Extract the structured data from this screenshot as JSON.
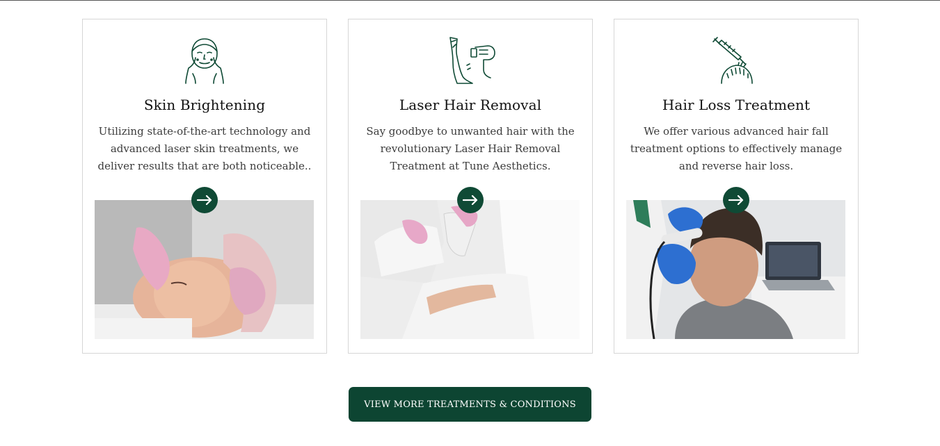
{
  "cards": [
    {
      "icon": "face-icon",
      "title": "Skin Brightening",
      "description": "Utilizing state-of-the-art technology and advanced laser skin treatments, we deliver results that are both noticeable..",
      "image": "facial-treatment-photo"
    },
    {
      "icon": "laser-leg-icon",
      "title": "Laser Hair Removal",
      "description": "Say goodbye to unwanted hair with the revolutionary Laser Hair Removal Treatment at Tune Aesthetics.",
      "image": "laser-hair-removal-photo"
    },
    {
      "icon": "syringe-scalp-icon",
      "title": "Hair Loss Treatment",
      "description": "We offer various advanced hair fall treatment options to effectively manage and reverse hair loss.",
      "image": "hair-loss-treatment-photo"
    }
  ],
  "cta": {
    "label": "VIEW MORE TREATMENTS & CONDITIONS"
  },
  "colors": {
    "accent": "#0d4532",
    "border": "#d6d6d6",
    "icon_stroke": "#0f4a35"
  }
}
